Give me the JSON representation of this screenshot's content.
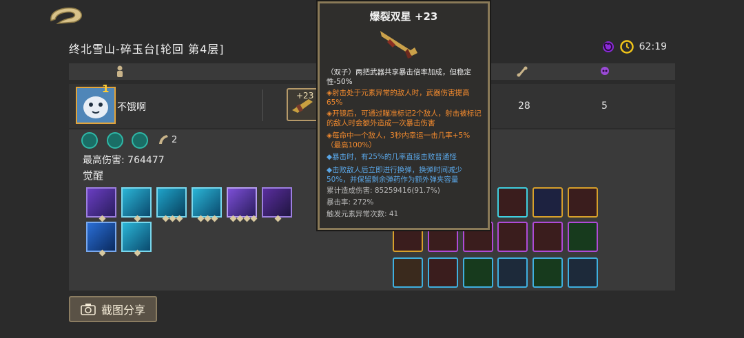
{
  "header": {
    "title": "终北雪山-碎玉台[轮回 第4层]",
    "timer": "62:19",
    "back_icon": "back-arrow-icon",
    "curse_icon": "swirl-icon",
    "clock_icon": "clock-icon"
  },
  "columns": {
    "player_icon": "person-icon",
    "bone_icon": "bone-icon",
    "skull_icon": "skull-icon"
  },
  "player": {
    "name": "不饿啊",
    "badge": "1",
    "weapon_level": "+23",
    "kills": "28",
    "deaths": "5"
  },
  "details": {
    "element_count": "2",
    "max_damage": "最高伤害: 764477",
    "awaken_label": "觉醒"
  },
  "share": {
    "label": "截图分享"
  },
  "tooltip": {
    "title": "爆裂双星 +23",
    "lines": [
      "（双子）两把武器共享暴击倍率加成，但稳定性-50%",
      "◈射击处于元素异常的敌人时，武器伤害提高65%",
      "◈开镜后，可通过瞄准标记2个敌人，射击被标记的敌人时会额外造成一次暴击伤害",
      "◈每命中一个敌人，3秒内幸运一击几率+5%（最高100%）",
      "◆暴击时，有25%的几率直接击败普通怪",
      "◆击败敌人后立即进行换弹，换弹时间减少50%，并保留剩余弹药作为额外弹夹容量",
      "累计造成伤害: 85259416(91.7%)",
      "暴击率: 272%",
      "触发元素异常次数: 41"
    ]
  },
  "colors": {
    "accent_orange": "#f28a2e",
    "accent_blue": "#5aa6e6",
    "gold_border": "#8a7a58"
  }
}
